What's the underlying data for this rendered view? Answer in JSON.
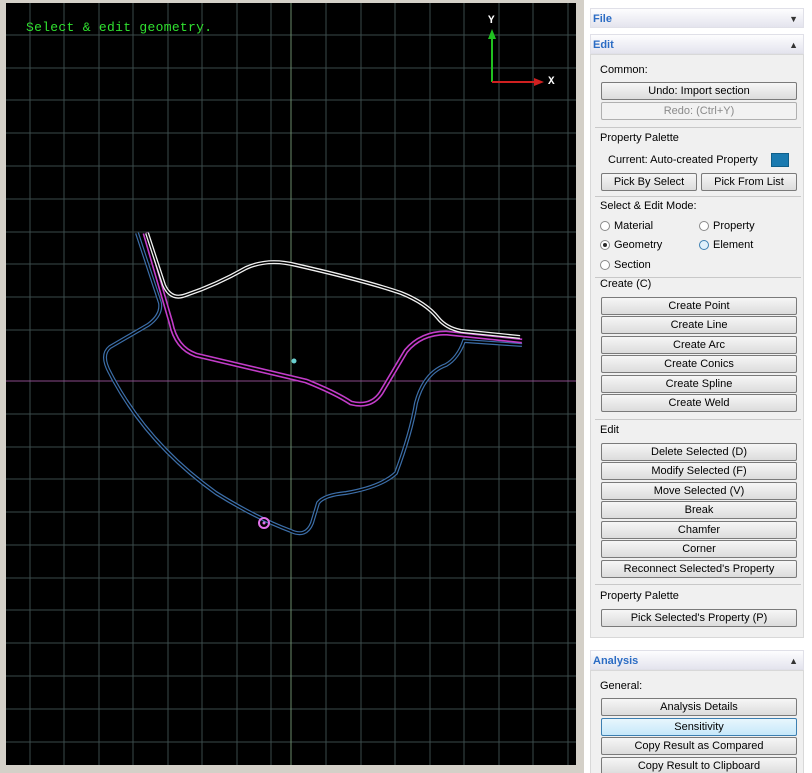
{
  "viewport": {
    "status_message": "Select & edit geometry.",
    "axis_y": "Y",
    "axis_x": "X"
  },
  "panel": {
    "file": {
      "title": "File"
    },
    "edit": {
      "title": "Edit",
      "common": {
        "label": "Common:",
        "undo": "Undo: Import section",
        "redo": "Redo: (Ctrl+Y)"
      },
      "property_palette": {
        "label": "Property Palette",
        "current": "Current: Auto-created Property",
        "current_color": "#1a7ab0",
        "pick_by_select": "Pick By Select",
        "pick_from_list": "Pick From List"
      },
      "mode": {
        "label": "Select & Edit Mode:",
        "options": [
          {
            "label": "Material",
            "selected": false
          },
          {
            "label": "Property",
            "selected": false
          },
          {
            "label": "Geometry",
            "selected": true
          },
          {
            "label": "Element",
            "selected": false
          },
          {
            "label": "Section",
            "selected": false
          }
        ]
      },
      "create": {
        "label": "Create (C)",
        "buttons": [
          "Create Point",
          "Create Line",
          "Create Arc",
          "Create Conics",
          "Create Spline",
          "Create Weld"
        ]
      },
      "edit_group": {
        "label": "Edit",
        "buttons": [
          "Delete Selected (D)",
          "Modify Selected (F)",
          "Move Selected (V)",
          "Break",
          "Chamfer",
          "Corner",
          "Reconnect Selected's Property"
        ]
      },
      "property_palette_2": {
        "label": "Property Palette",
        "button": "Pick Selected's Property (P)"
      }
    },
    "analysis": {
      "title": "Analysis",
      "general": {
        "label": "General:",
        "buttons": [
          "Analysis Details",
          "Sensitivity",
          "Copy Result as Compared",
          "Copy Result to Clipboard"
        ]
      }
    }
  }
}
